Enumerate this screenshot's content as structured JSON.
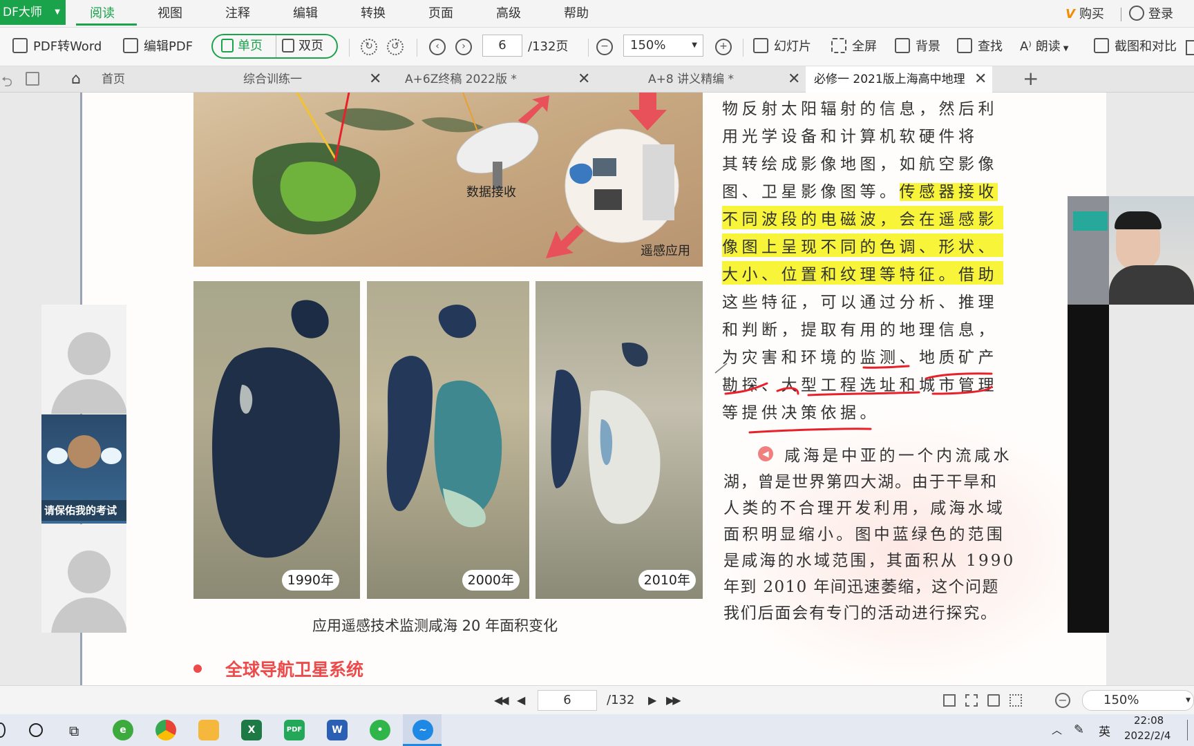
{
  "app": {
    "brand": "DF大师",
    "menu": [
      "阅读",
      "视图",
      "注释",
      "编辑",
      "转换",
      "页面",
      "高级",
      "帮助"
    ],
    "buy": "购买",
    "login": "登录"
  },
  "toolbar": {
    "pdf_to_word": "PDF转Word",
    "edit_pdf": "编辑PDF",
    "single_page": "单页",
    "double_page": "双页",
    "current_page": "6",
    "total_pages": "/132页",
    "zoom": "150%",
    "slideshow": "幻灯片",
    "fullscreen": "全屏",
    "background": "背景",
    "find": "查找",
    "read_aloud": "朗读",
    "screenshot_compare": "截图和对比"
  },
  "tabs": [
    {
      "label": "首页"
    },
    {
      "label": "综合训练一"
    },
    {
      "label": "A+6Z终稿 2022版 *"
    },
    {
      "label": "A+8 讲义精编 *"
    },
    {
      "label": "必修一 2021版上海高中地理..."
    }
  ],
  "page": {
    "diagram_labels": {
      "receive": "数据接收",
      "apply": "遥感应用"
    },
    "years": [
      "1990年",
      "2000年",
      "2010年"
    ],
    "caption": "应用遥感技术监测咸海 20 年面积变化",
    "section_title": "全球导航卫星系统",
    "para1": [
      "物反射太阳辐射的信息，然后利",
      "用光学设备和计算机软硬件将",
      "其转绘成影像地图，如航空影像",
      "图、卫星影像图等。",
      "传感器接收",
      "不同波段的电磁波，会在遥感影",
      "像图上呈现不同的色调、形状、",
      "大小、位置和纹理等特征。借助",
      "这些特征，可以通过分析、推理",
      "和判断，提取有用的地理信息，",
      "为灾害和环境的监测、地质矿产",
      "勘探、大型工程选址和城市管理",
      "等提供决策依据。"
    ],
    "para2": [
      "咸海是中亚的一个内流咸水",
      "湖，曾是世界第四大湖。由于干旱和",
      "人类的不合理开发利用，咸海水域",
      "面积明显缩小。图中蓝绿色的范围",
      "是咸海的水域范围，其面积从 1990",
      "年到 2010 年间迅速萎缩，这个问题",
      "我们后面会有专门的活动进行探究。"
    ]
  },
  "webcam": {
    "caption": "请保佑我的考试"
  },
  "statusbar": {
    "page": "6",
    "total": "/132",
    "zoom": "150%"
  },
  "taskbar": {
    "ime": "英",
    "time": "22:08",
    "date": "2022/2/4"
  },
  "colors": {
    "accent": "#1aa34a",
    "highlight": "#f7f43a",
    "ink_red": "#e8202a",
    "section_red": "#ec4b4b"
  }
}
